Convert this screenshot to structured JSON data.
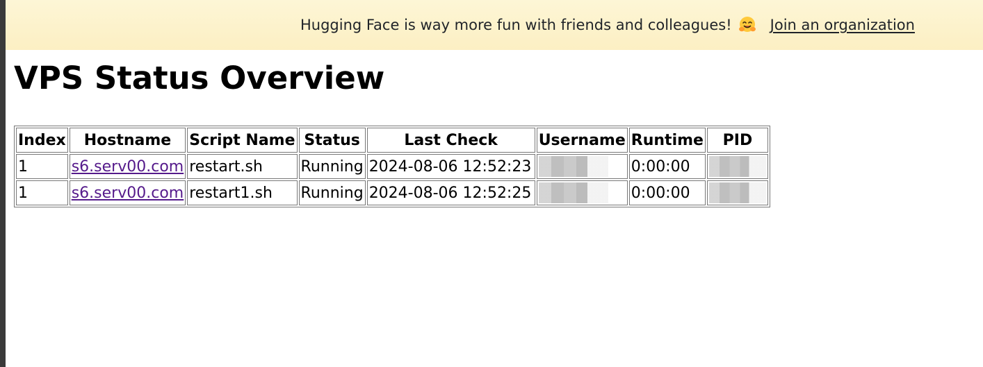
{
  "banner": {
    "message": "Hugging Face is way more fun with friends and colleagues!",
    "icon": "hugging-face-emoji-icon",
    "link_label": "Join an organization"
  },
  "page": {
    "title": "VPS Status Overview"
  },
  "table": {
    "headers": [
      "Index",
      "Hostname",
      "Script Name",
      "Status",
      "Last Check",
      "Username",
      "Runtime",
      "PID"
    ],
    "rows": [
      {
        "index": "1",
        "hostname": "s6.serv00.com",
        "script_name": "restart.sh",
        "status": "Running",
        "last_check": "2024-08-06 12:52:23",
        "username": "",
        "runtime": "0:00:00",
        "pid": ""
      },
      {
        "index": "1",
        "hostname": "s6.serv00.com",
        "script_name": "restart1.sh",
        "status": "Running",
        "last_check": "2024-08-06 12:52:25",
        "username": "",
        "runtime": "0:00:00",
        "pid": ""
      }
    ]
  },
  "colors": {
    "banner_bg": "#fcefc3",
    "visited_link": "#551a8b"
  }
}
